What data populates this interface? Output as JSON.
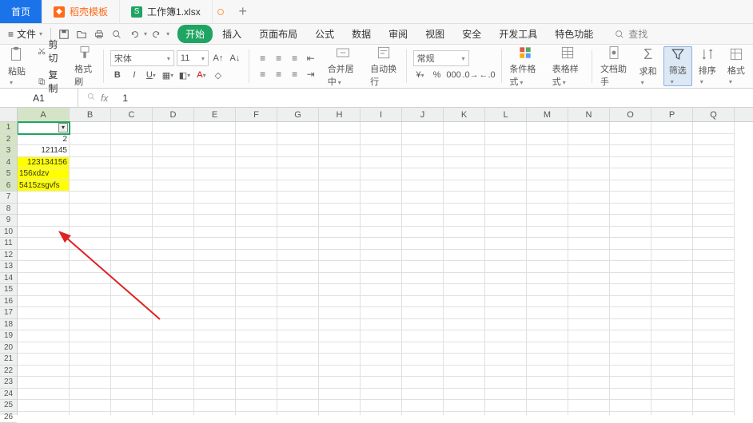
{
  "tabs": {
    "home": "首页",
    "template": "稻壳模板",
    "file": "工作簿1.xlsx"
  },
  "menubar": {
    "file": "文件",
    "items": [
      "开始",
      "插入",
      "页面布局",
      "公式",
      "数据",
      "审阅",
      "视图",
      "安全",
      "开发工具",
      "特色功能"
    ],
    "search": "查找"
  },
  "ribbon": {
    "paste": "粘贴",
    "cut": "剪切",
    "copy": "复制",
    "format_painter": "格式刷",
    "font_name": "宋体",
    "font_size": "11",
    "merge_center": "合并居中",
    "wrap_text": "自动换行",
    "number_format": "常规",
    "cond_fmt": "条件格式",
    "table_style": "表格样式",
    "doc_helper": "文档助手",
    "sum": "求和",
    "filter": "筛选",
    "sort": "排序",
    "format": "格式"
  },
  "fxbar": {
    "namebox": "A1",
    "formula": "1"
  },
  "columns": [
    "A",
    "B",
    "C",
    "D",
    "E",
    "F",
    "G",
    "H",
    "I",
    "J",
    "K",
    "L",
    "M",
    "N",
    "O",
    "P",
    "Q"
  ],
  "row_count": 26,
  "selected_rows": [
    1,
    2,
    3,
    4,
    5,
    6
  ],
  "cells": {
    "A2": {
      "value": "2",
      "highlight": false,
      "align": "right"
    },
    "A3": {
      "value": "121145",
      "highlight": false,
      "align": "right"
    },
    "A4": {
      "value": "123134156",
      "highlight": true,
      "align": "right"
    },
    "A5": {
      "value": "156xdzv",
      "highlight": true,
      "align": "left"
    },
    "A6": {
      "value": "5415zsgvfs",
      "highlight": true,
      "align": "left"
    }
  }
}
